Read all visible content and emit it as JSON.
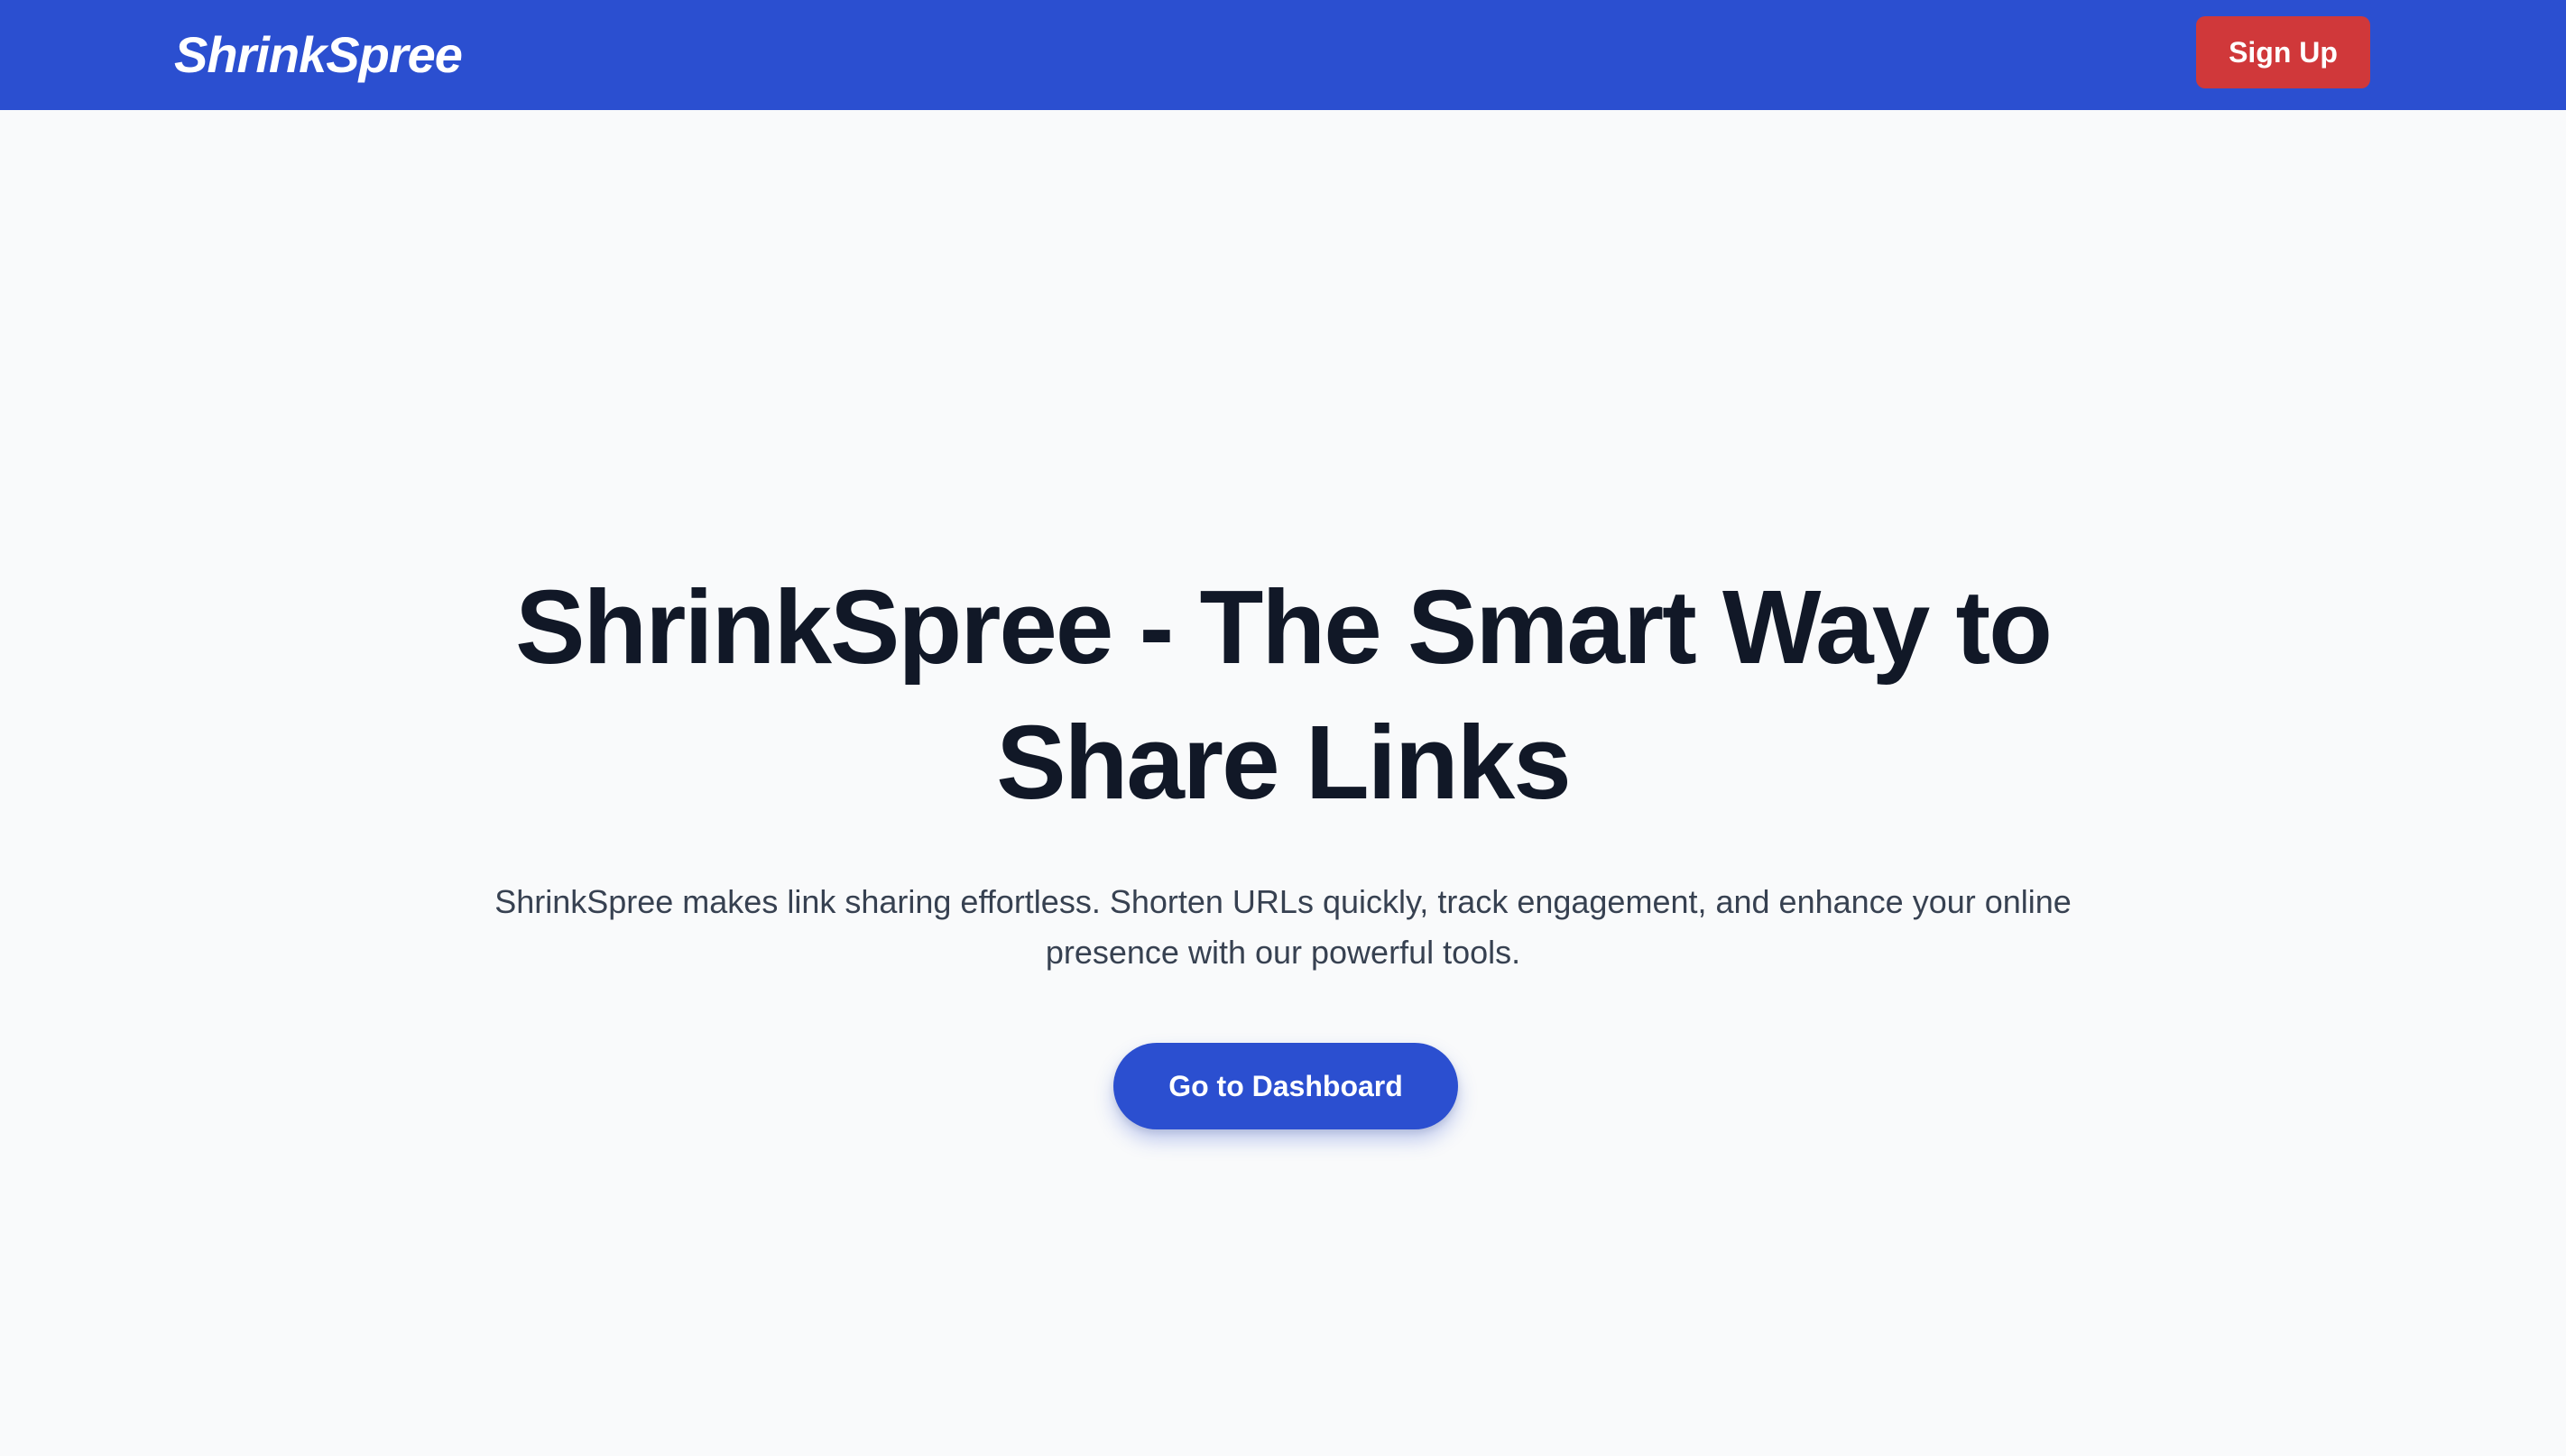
{
  "navbar": {
    "brand": "ShrinkSpree",
    "signup_label": "Sign Up"
  },
  "hero": {
    "title": "ShrinkSpree - The Smart Way to Share Links",
    "subtitle": "ShrinkSpree makes link sharing effortless. Shorten URLs quickly, track engagement, and enhance your online presence with our powerful tools.",
    "cta_label": "Go to Dashboard"
  },
  "colors": {
    "navbar_bg": "#2b4fd0",
    "signup_bg": "#d0383a",
    "page_bg": "#f9fafb",
    "title_text": "#111827",
    "subtitle_text": "#374151",
    "cta_bg": "#2b4fd0"
  }
}
